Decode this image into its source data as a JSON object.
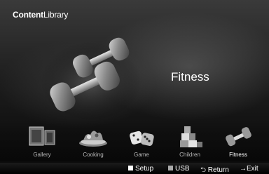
{
  "app_title": {
    "bold": "Content",
    "rest": "Library"
  },
  "hero": {
    "title": "Fitness",
    "icon": "dumbbell-icon"
  },
  "categories": [
    {
      "label": "Gallery",
      "icon": "gallery-icon"
    },
    {
      "label": "Cooking",
      "icon": "cooking-icon"
    },
    {
      "label": "Game",
      "icon": "dice-icon"
    },
    {
      "label": "Children",
      "icon": "blocks-icon"
    },
    {
      "label": "Fitness",
      "icon": "dumbbell-icon",
      "selected": true
    }
  ],
  "bottom_bar": {
    "setup": "Setup",
    "usb": "USB",
    "return": "Return",
    "exit": "Exit"
  }
}
